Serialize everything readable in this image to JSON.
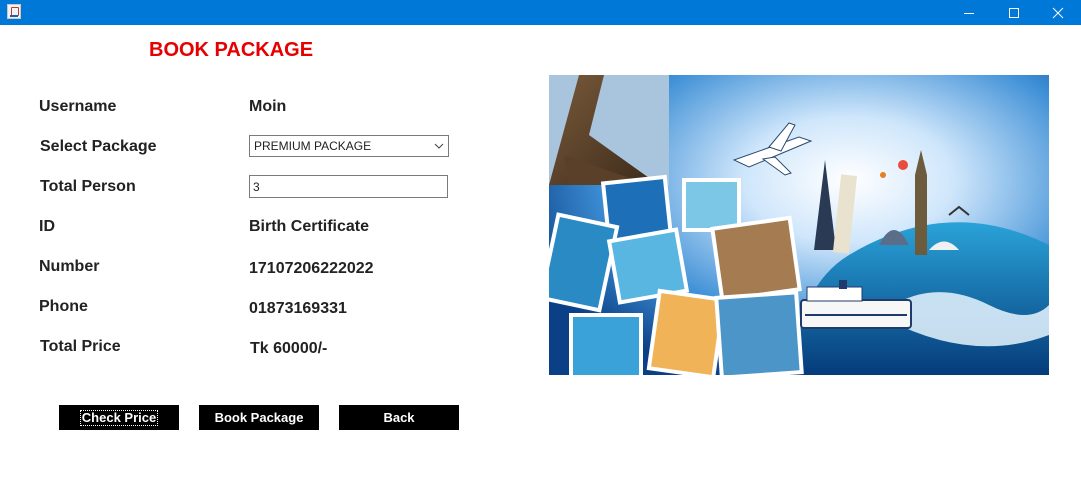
{
  "window": {
    "icon": "java-app-icon",
    "controls": [
      "minimize-icon",
      "maximize-icon",
      "close-icon"
    ]
  },
  "form": {
    "title": "BOOK PACKAGE",
    "labels": {
      "username": "Username",
      "package": "Select Package",
      "persons": "Total Person",
      "id": "ID",
      "number": "Number",
      "phone": "Phone",
      "price": "Total Price"
    },
    "values": {
      "username": "Moin",
      "package_selected": "PREMIUM PACKAGE",
      "persons": "3",
      "id": "Birth Certificate",
      "number": "17107206222022",
      "phone": "01873169331",
      "price": "Tk 60000/-"
    }
  },
  "buttons": {
    "check_price": "Check Price",
    "book_package": "Book Package",
    "back": "Back"
  },
  "colors": {
    "titlebar": "#0078d7",
    "heading": "#e60000",
    "button_bg": "#000000",
    "button_text": "#ffffff"
  }
}
